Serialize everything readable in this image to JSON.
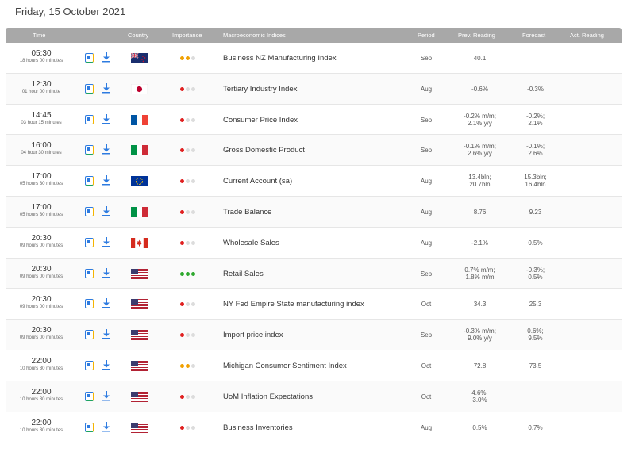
{
  "date_title": "Friday, 15 October 2021",
  "columns": {
    "time": "Time",
    "country": "Country",
    "importance": "Importance",
    "indicator": "Macroeconomic Indices",
    "period": "Period",
    "prev": "Prev. Reading",
    "forecast": "Forecast",
    "actual": "Act. Reading"
  },
  "colors": {
    "red": "#e02020",
    "orange": "#f0a000",
    "green": "#2ea82e",
    "grey": "#dcdcdc",
    "header": "#a8a8a8"
  },
  "rows": [
    {
      "time": "05:30",
      "countdown": "18 hours 00 minutes",
      "country": "NZ",
      "importance": "orange2",
      "indicator": "Business NZ Manufacturing Index",
      "period": "Sep",
      "prev": [
        "40.1"
      ],
      "forecast": []
    },
    {
      "time": "12:30",
      "countdown": "01 hour 00 minute",
      "country": "JP",
      "importance": "red1",
      "indicator": "Tertiary Industry Index",
      "period": "Aug",
      "prev": [
        "-0.6%"
      ],
      "forecast": [
        "-0.3%"
      ]
    },
    {
      "time": "14:45",
      "countdown": "03 hour 15 minutes",
      "country": "FR",
      "importance": "red1",
      "indicator": "Consumer Price Index",
      "period": "Sep",
      "prev": [
        "-0.2% m/m;",
        "2.1% y/y"
      ],
      "forecast": [
        "-0.2%;",
        "2.1%"
      ]
    },
    {
      "time": "16:00",
      "countdown": "04 hour 30 minutes",
      "country": "IT",
      "importance": "red1",
      "indicator": "Gross Domestic Product",
      "period": "Sep",
      "prev": [
        "-0.1% m/m;",
        "2.6% y/y"
      ],
      "forecast": [
        "-0.1%;",
        "2.6%"
      ]
    },
    {
      "time": "17:00",
      "countdown": "05 hours 30 minutes",
      "country": "EU",
      "importance": "red1",
      "indicator": "Current Account (sa)",
      "period": "Aug",
      "prev": [
        "13.4bln;",
        "20.7bln"
      ],
      "forecast": [
        "15.3bln;",
        "16.4bln"
      ]
    },
    {
      "time": "17:00",
      "countdown": "05 hours 30 minutes",
      "country": "IT",
      "importance": "red1",
      "indicator": "Trade Balance",
      "period": "Aug",
      "prev": [
        "8.76"
      ],
      "forecast": [
        "9.23"
      ]
    },
    {
      "time": "20:30",
      "countdown": "09 hours 00 minutes",
      "country": "CA",
      "importance": "red1",
      "indicator": "Wholesale Sales",
      "period": "Aug",
      "prev": [
        "-2.1%"
      ],
      "forecast": [
        "0.5%"
      ]
    },
    {
      "time": "20:30",
      "countdown": "09 hours 00 minutes",
      "country": "US",
      "importance": "green3",
      "indicator": "Retail Sales",
      "period": "Sep",
      "prev": [
        "0.7% m/m;",
        "1.8% m/m"
      ],
      "forecast": [
        "-0.3%;",
        "0.5%"
      ]
    },
    {
      "time": "20:30",
      "countdown": "09 hours 00 minutes",
      "country": "US",
      "importance": "red1",
      "indicator": "NY Fed Empire State manufacturing index",
      "period": "Oct",
      "prev": [
        "34.3"
      ],
      "forecast": [
        "25.3"
      ]
    },
    {
      "time": "20:30",
      "countdown": "09 hours 00 minutes",
      "country": "US",
      "importance": "red1",
      "indicator": "Import price index",
      "period": "Sep",
      "prev": [
        "-0.3% m/m;",
        "9.0% y/y"
      ],
      "forecast": [
        "0.6%;",
        "9.5%"
      ]
    },
    {
      "time": "22:00",
      "countdown": "10 hours 30 minutes",
      "country": "US",
      "importance": "orange2",
      "indicator": "Michigan Consumer Sentiment Index",
      "period": "Oct",
      "prev": [
        "72.8"
      ],
      "forecast": [
        "73.5"
      ]
    },
    {
      "time": "22:00",
      "countdown": "10 hours 30 minutes",
      "country": "US",
      "importance": "red1",
      "indicator": "UoM Inflation Expectations",
      "period": "Oct",
      "prev": [
        "4.6%;",
        "3.0%"
      ],
      "forecast": []
    },
    {
      "time": "22:00",
      "countdown": "10 hours 30 minutes",
      "country": "US",
      "importance": "red1",
      "indicator": "Business Inventories",
      "period": "Aug",
      "prev": [
        "0.5%"
      ],
      "forecast": [
        "0.7%"
      ]
    }
  ]
}
